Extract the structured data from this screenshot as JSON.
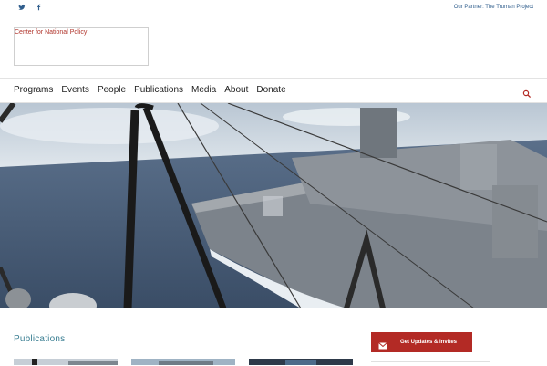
{
  "top": {
    "social_icons": [
      "twitter-icon",
      "facebook-icon"
    ],
    "partner_link": "Our Partner: The Truman Project"
  },
  "logo": {
    "text": "Center for National Policy"
  },
  "nav": {
    "items": [
      "Programs",
      "Events",
      "People",
      "Publications",
      "Media",
      "About",
      "Donate"
    ],
    "search_icon": "search-icon"
  },
  "hero": {
    "image_alt": ""
  },
  "publications": {
    "title": "Publications"
  },
  "cta": {
    "label": "Get Updates & Invites",
    "icon": "envelope-icon"
  },
  "colors": {
    "accent_red": "#b32a25",
    "link_blue": "#2f5d8c",
    "section_teal": "#3b7f93",
    "logo_red": "#b0342b"
  }
}
